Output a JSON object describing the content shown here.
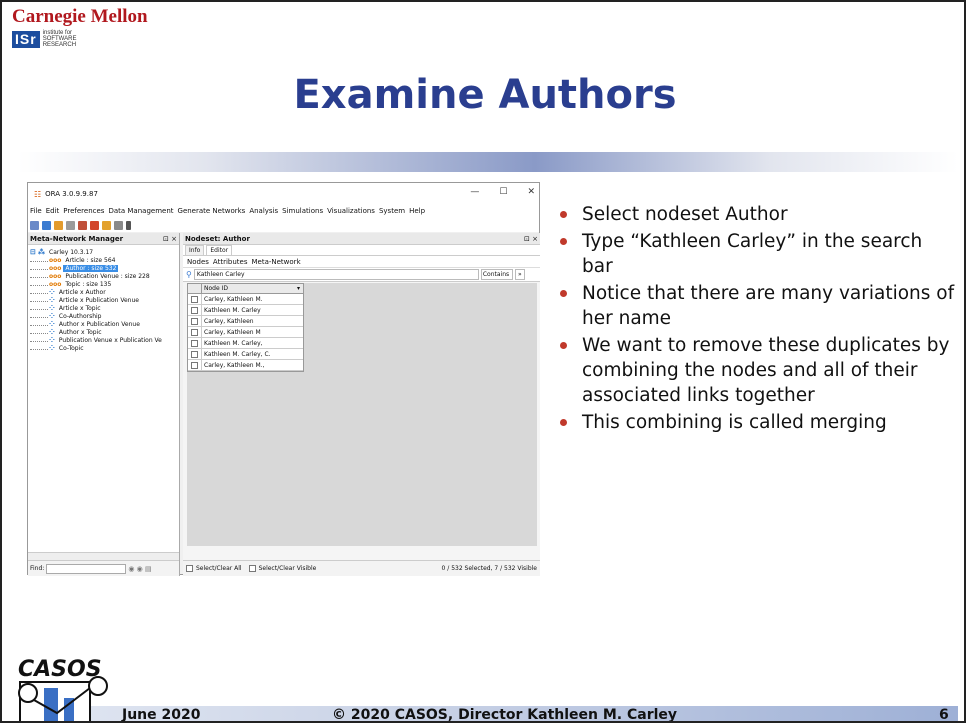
{
  "header": {
    "university": "Carnegie Mellon",
    "isr_logo": "ISr",
    "isr_lines": [
      "institute for",
      "SOFTWARE",
      "RESEARCH"
    ],
    "title": "Examine Authors"
  },
  "app": {
    "window_title": "ORA 3.0.9.9.87",
    "menu": [
      "File",
      "Edit",
      "Preferences",
      "Data Management",
      "Generate Networks",
      "Analysis",
      "Simulations",
      "Visualizations",
      "System",
      "Help"
    ],
    "left_pane_title": "Meta-Network Manager",
    "tree": {
      "root": "Carley 10.3.17",
      "items": [
        {
          "label": "Article : size 564",
          "icon": "nodeset-icon",
          "selected": false
        },
        {
          "label": "Author : size 532",
          "icon": "nodeset-icon",
          "selected": true
        },
        {
          "label": "Publication Venue : size 228",
          "icon": "nodeset-icon",
          "selected": false
        },
        {
          "label": "Topic : size 135",
          "icon": "nodeset-icon",
          "selected": false
        },
        {
          "label": "Article x Author",
          "icon": "network-icon",
          "selected": false
        },
        {
          "label": "Article x Publication Venue",
          "icon": "network-icon",
          "selected": false
        },
        {
          "label": "Article x Topic",
          "icon": "network-icon",
          "selected": false
        },
        {
          "label": "Co-Authorship",
          "icon": "network-icon",
          "selected": false
        },
        {
          "label": "Author x Publication Venue",
          "icon": "network-icon",
          "selected": false
        },
        {
          "label": "Author x Topic",
          "icon": "network-icon",
          "selected": false
        },
        {
          "label": "Publication Venue x Publication Ve",
          "icon": "network-icon",
          "selected": false
        },
        {
          "label": "Co-Topic",
          "icon": "network-icon",
          "selected": false
        }
      ]
    },
    "find_label": "Find:",
    "right_pane_title": "Nodeset: Author",
    "inner_tabs": [
      "Info",
      "Editor"
    ],
    "sub_tabs": [
      "Nodes",
      "Attributes",
      "Meta-Network"
    ],
    "search_value": "Kathleen Carley",
    "contains_label": "Contains",
    "grid_header": "Node ID",
    "rows": [
      "Carley, Kathleen M.",
      "Kathleen M. Carley",
      "Carley, Kathleen",
      "Carley, Kathleen M",
      "Kathleen M. Carley,",
      "Kathleen M. Carley, C.",
      "Carley, Kathleen M.,"
    ],
    "select_clear_all": "Select/Clear All",
    "select_clear_visible": "Select/Clear Visible",
    "status": "0 / 532 Selected, 7 / 532 Visible"
  },
  "bullets": [
    "Select nodeset Author",
    "Type “Kathleen Carley” in the search bar",
    "Notice that there are many variations of her name",
    "We want to remove these duplicates by combining the nodes and all of their associated links together",
    "This combining is called merging"
  ],
  "footer": {
    "logo_text": "CASOS",
    "date": "June 2020",
    "copyright": "© 2020 CASOS, Director Kathleen M. Carley",
    "page": "6"
  },
  "colors": {
    "title": "#2a3e8f",
    "cmu_red": "#b1181e",
    "bullet": "#c0392b",
    "selection": "#3a8ee6"
  }
}
